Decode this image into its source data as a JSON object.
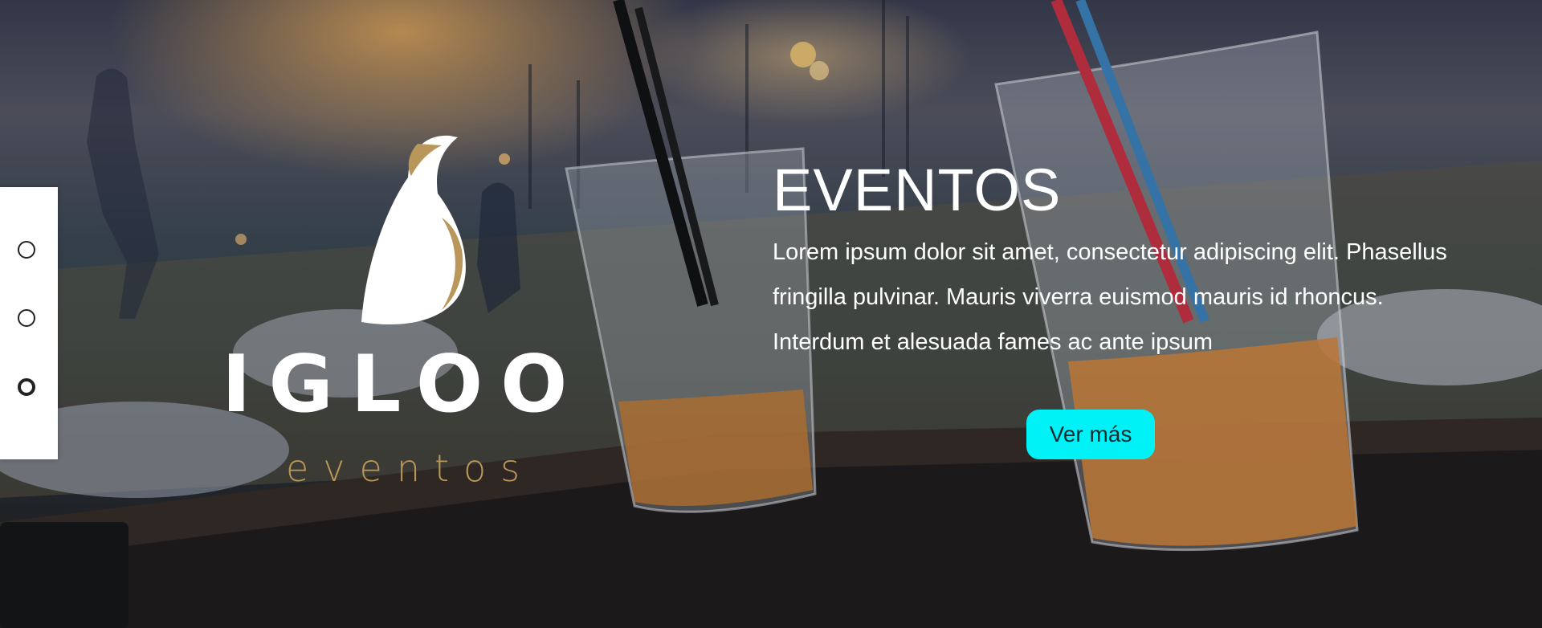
{
  "logo": {
    "wordmark": "IGLOO",
    "subtitle": "eventos"
  },
  "hero": {
    "title": "EVENTOS",
    "description": "Lorem ipsum dolor sit amet, consectetur adipiscing elit. Phasellus fringilla pulvinar. Mauris viverra euismod mauris id rhoncus. Interdum et alesuada  fames ac ante ipsum",
    "cta_label": "Ver más"
  },
  "slider": {
    "slides": 3,
    "active_index": 3
  },
  "colors": {
    "accent_cta": "#00f2f7",
    "logo_gold": "#b99659",
    "text": "#ffffff"
  }
}
